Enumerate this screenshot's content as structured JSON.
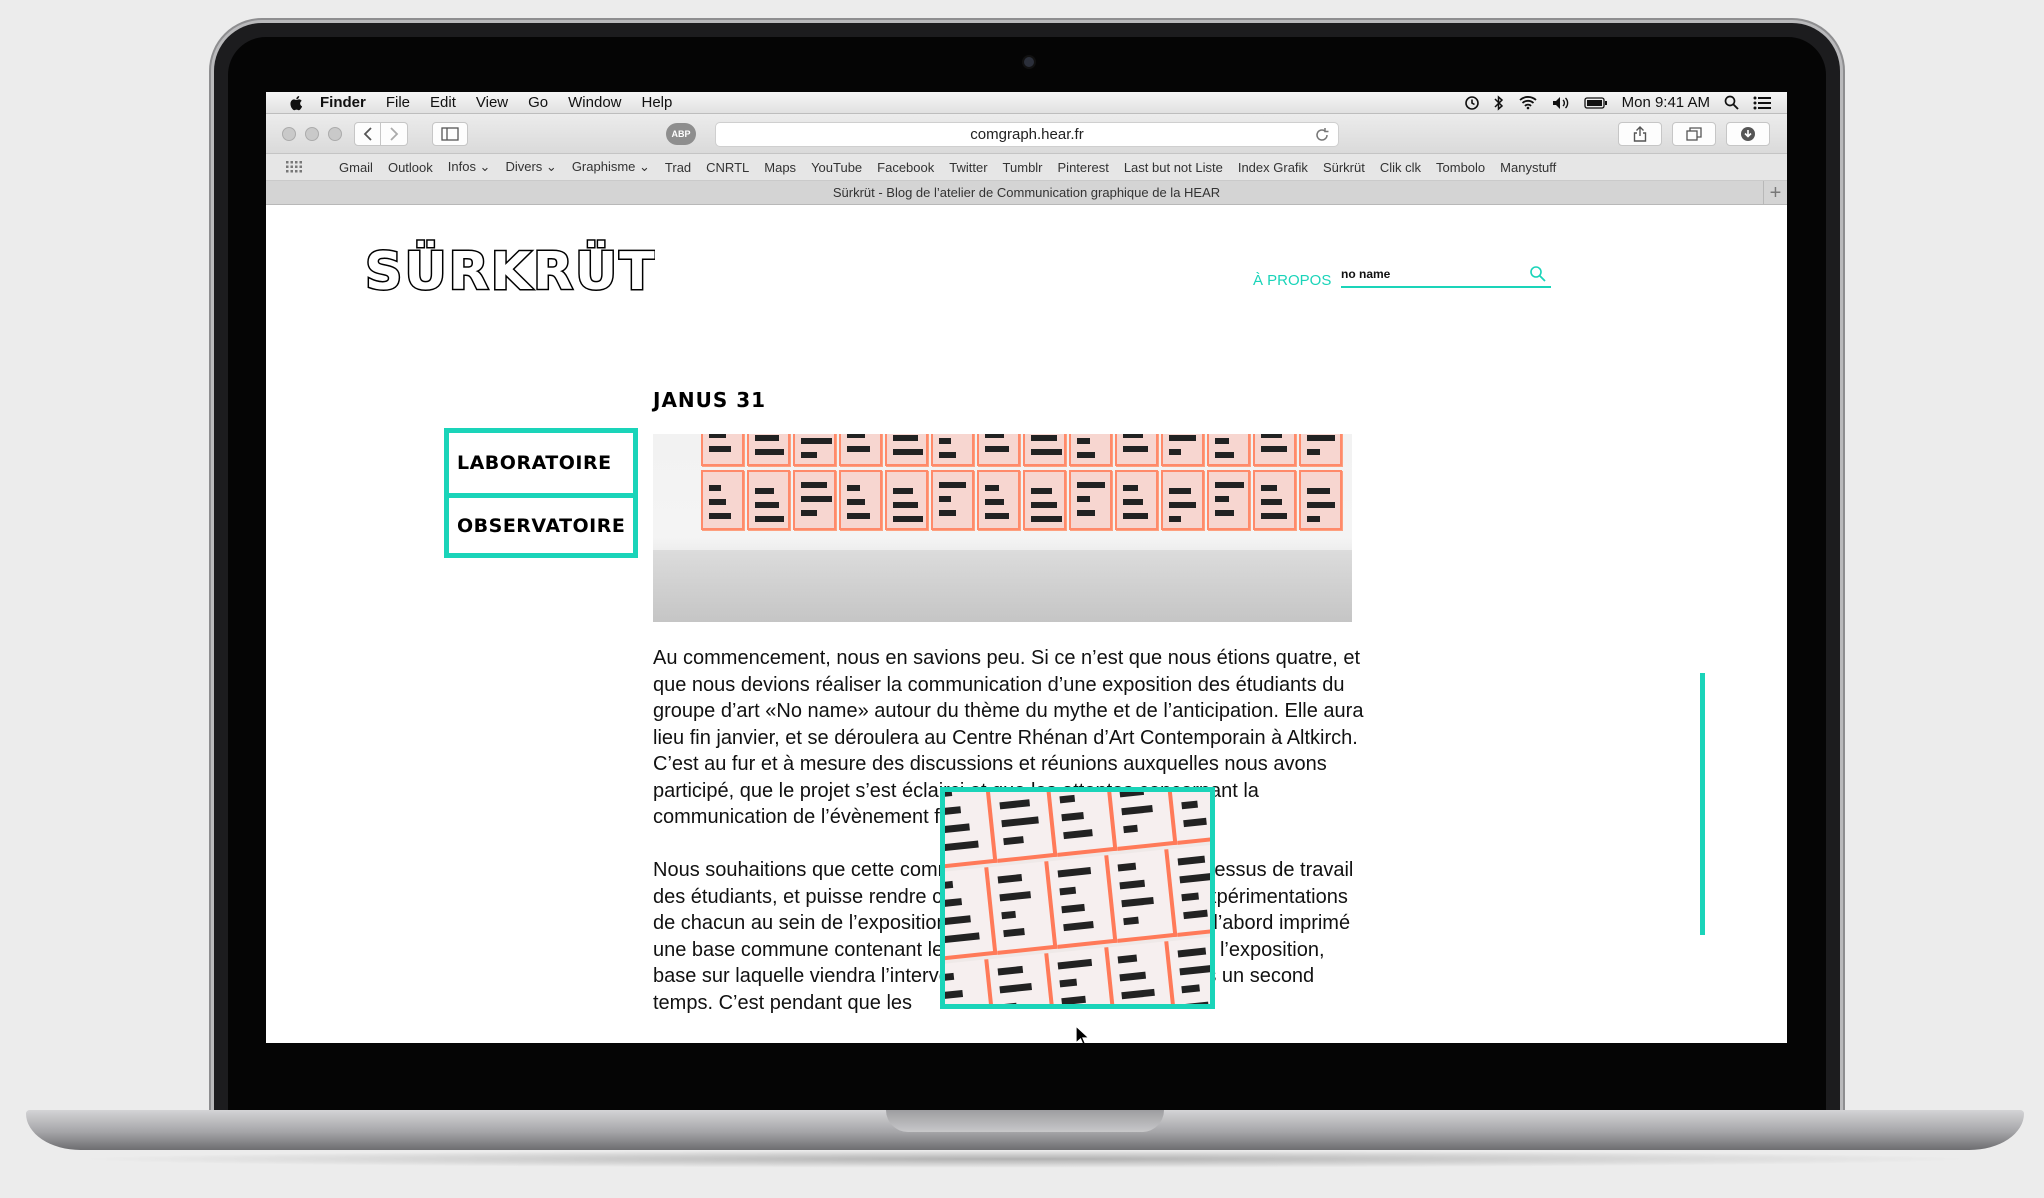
{
  "menubar": {
    "app_name": "Finder",
    "items": [
      "File",
      "Edit",
      "View",
      "Go",
      "Window",
      "Help"
    ],
    "clock": "Mon 9:41 AM"
  },
  "toolbar": {
    "adblock_label": "ABP",
    "url": "comgraph.hear.fr"
  },
  "bookmarks": [
    "Gmail",
    "Outlook",
    "Infos ⌄",
    "Divers ⌄",
    "Graphisme ⌄",
    "Trad",
    "CNRTL",
    "Maps",
    "YouTube",
    "Facebook",
    "Twitter",
    "Tumblr",
    "Pinterest",
    "Last but not Liste",
    "Index Grafik",
    "Sürkrüt",
    "Clik clk",
    "Tombolo",
    "Manystuff"
  ],
  "tab": {
    "title": "Sürkrüt - Blog de l’atelier de Communication graphique de la HEAR",
    "new_tab": "+"
  },
  "site": {
    "logo": "SÜRKRÜT",
    "apropos": "À PROPOS",
    "search_value": "no name",
    "post_title": "JANUS 31",
    "nav": [
      "LABORATOIRE",
      "OBSERVATOIRE"
    ],
    "accent_color": "#1ad4b9"
  },
  "article": {
    "paragraphs": [
      "Au commencement, nous en savions peu. Si ce n’est que nous étions quatre, et que nous devions réaliser la communication d’une exposition des étudiants du groupe d’art «No name» autour du thème du mythe et de l’anticipation. Elle aura lieu fin janvier, et se déroulera au Centre Rhénan d’Art Contemporain à Altkirch. C’est au fur et à mesure des discussions et réunions auxquelles nous avons participé, que le projet s’est éclairci et que les attentes concernant la communication de l’évènement furent plus détaillées.",
      "Nous souhaitions que cette communication soit le reflet du processus de travail des étudiants, et puisse rendre compte des pistes lancées et expérimentations de chacun au sein de l’exposition. C’est pourquoi, nous avons d’abord imprimé une base commune contenant les informations principales pour l’exposition, base sur laquelle viendra l’intervention manuelle effectuée dans un second temps. C’est pendant que les"
    ]
  },
  "icons": [
    "apple-icon",
    "time-machine-icon",
    "bluetooth-icon",
    "wifi-icon",
    "volume-icon",
    "battery-icon",
    "spotlight-icon",
    "notification-center-icon",
    "back-icon",
    "forward-icon",
    "sidebar-icon",
    "reload-icon",
    "share-icon",
    "tabs-overview-icon",
    "downloads-icon",
    "grid-icon",
    "search-icon",
    "cursor-icon"
  ]
}
